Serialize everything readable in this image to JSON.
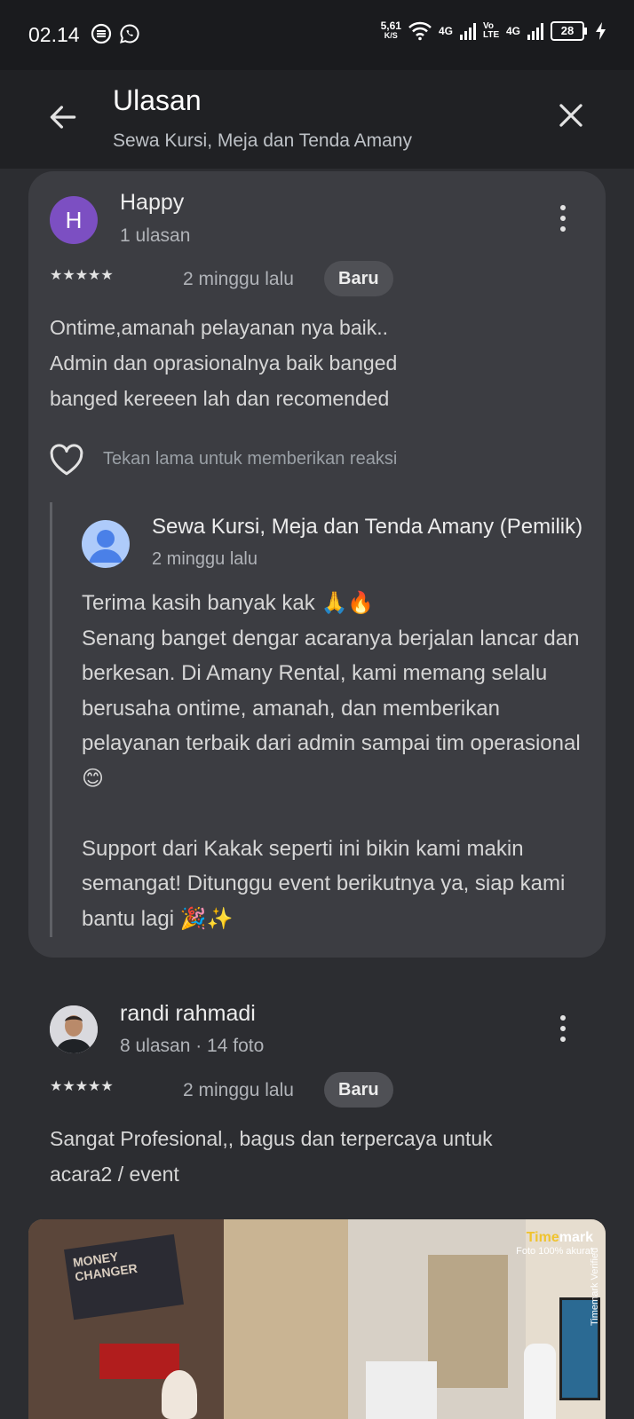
{
  "status_bar": {
    "time": "02.14",
    "net_speed": "5,61",
    "net_unit": "K/S",
    "sig1_label": "4G",
    "volte": "Vo LTE",
    "sig2_label": "4G",
    "battery": "28"
  },
  "header": {
    "title": "Ulasan",
    "subtitle": "Sewa Kursi, Meja dan Tenda Amany"
  },
  "reviews": [
    {
      "author": "Happy",
      "avatar_letter": "H",
      "meta": "1 ulasan",
      "rating": 5,
      "stars": "★★★★★",
      "age": "2 minggu lalu",
      "badge": "Baru",
      "text": "Ontime,amanah pelayanan nya baik..\nAdmin dan oprasionalnya baik banged\nbanged kereeen lah dan recomended",
      "reaction_hint": "Tekan lama untuk memberikan reaksi",
      "owner_reply": {
        "name": "Sewa Kursi, Meja dan Tenda Amany (Pemilik)",
        "age": "2 minggu lalu",
        "text": "Terima kasih banyak kak 🙏🔥\nSenang banget dengar acaranya berjalan lancar dan berkesan. Di Amany Rental, kami memang selalu berusaha ontime, amanah, dan memberikan pelayanan terbaik dari admin sampai tim operasional 😊\n\nSupport dari Kakak seperti ini bikin kami makin semangat! Ditunggu event berikutnya ya, siap kami bantu lagi 🎉✨"
      }
    },
    {
      "author": "randi rahmadi",
      "meta": "8 ulasan · 14 foto",
      "rating": 5,
      "stars": "★★★★★",
      "age": "2 minggu lalu",
      "badge": "Baru",
      "text": "Sangat Profesional,, bagus dan terpercaya untuk\nacara2 / event",
      "photo": {
        "stamp_brand_a": "Time",
        "stamp_brand_b": "mark",
        "stamp_sub": "Foto 100% akurat",
        "sign_text": "MONEY CHANGER",
        "verified_text": "Timemark Verified"
      }
    }
  ]
}
